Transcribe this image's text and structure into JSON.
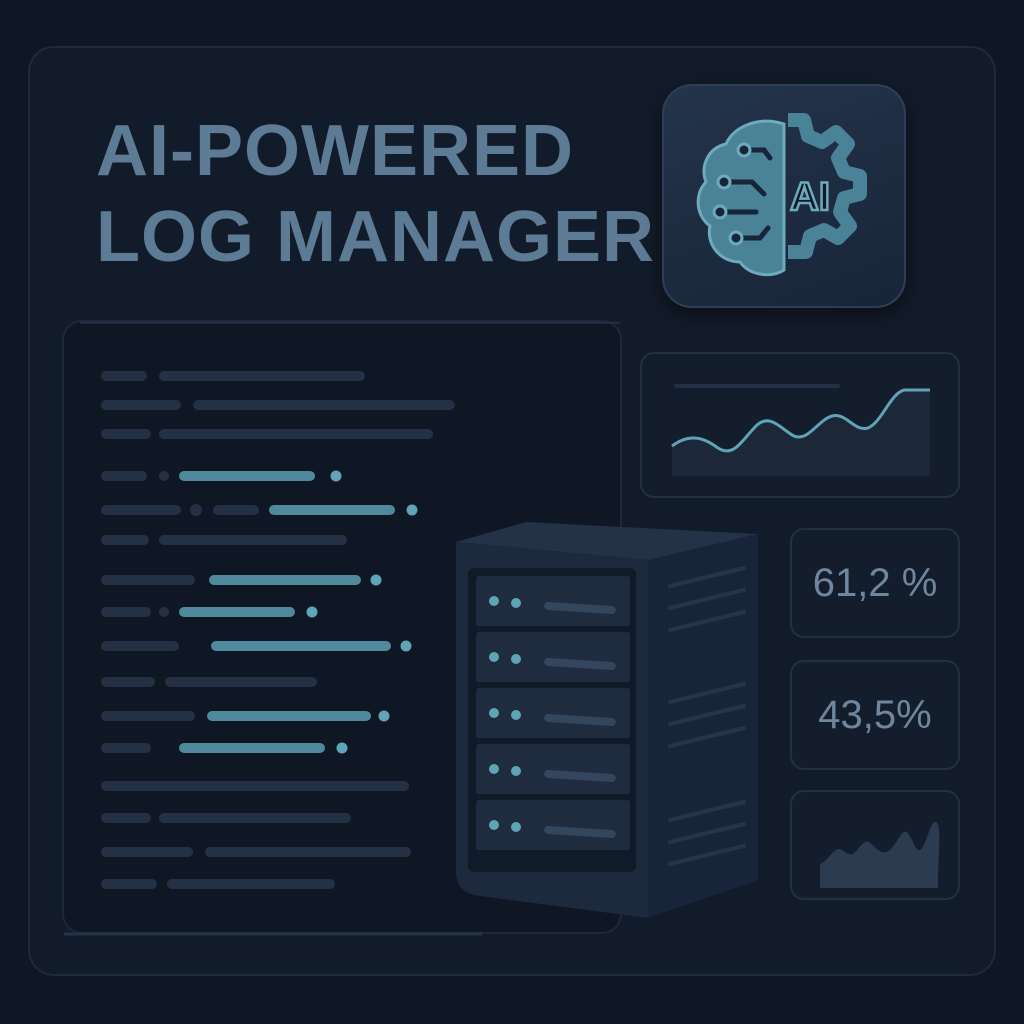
{
  "title": {
    "line1": "AI-POWERED",
    "line2": "LOG MANAGER"
  },
  "app_icon": {
    "icon": "ai-brain-gear-icon",
    "label": "AI"
  },
  "stats": {
    "cpu": "61,2 %",
    "memory": "43,5%"
  },
  "colors": {
    "background": "#0f1724",
    "accent": "#5fa4b4",
    "title": "#5e7b95"
  }
}
